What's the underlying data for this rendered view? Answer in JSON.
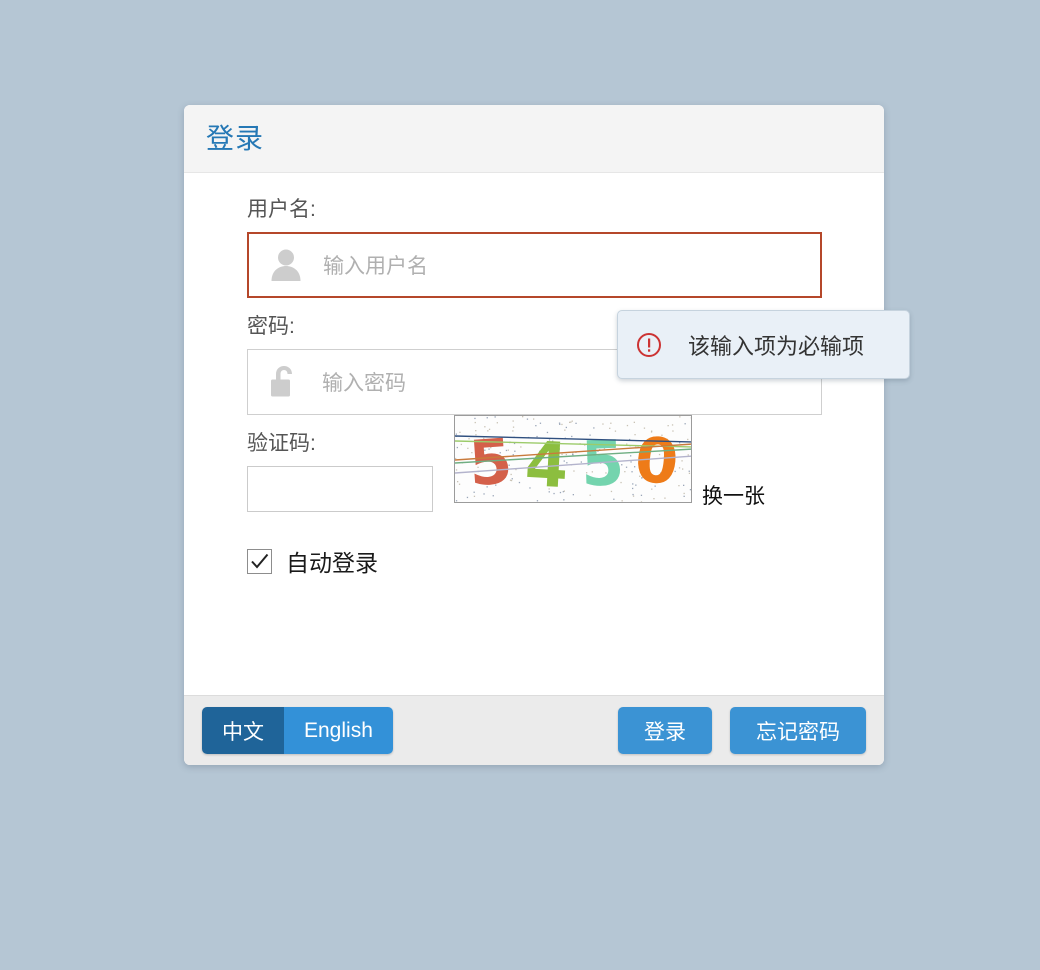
{
  "page": {
    "background_color": "#b5c6d4"
  },
  "panel": {
    "title": "登录",
    "title_color": "#2578b5"
  },
  "form": {
    "username": {
      "label": "用户名:",
      "placeholder": "输入用户名",
      "value": "",
      "icon": "user-icon",
      "error": true,
      "error_border_color": "#b5472a"
    },
    "password": {
      "label": "密码:",
      "placeholder": "输入密码",
      "value": "",
      "icon": "unlock-icon"
    },
    "captcha": {
      "label": "验证码:",
      "value": "",
      "placeholder": "",
      "image_text": "5450",
      "image_digits": [
        {
          "char": "5",
          "color": "#d4604a"
        },
        {
          "char": "4",
          "color": "#8cbe3f"
        },
        {
          "char": "5",
          "color": "#74d4ae"
        },
        {
          "char": "0",
          "color": "#ee7b18"
        }
      ],
      "refresh_label": "换一张"
    },
    "auto_login": {
      "label": "自动登录",
      "checked": true
    }
  },
  "tooltip": {
    "message": "该输入项为必输项",
    "icon": "error-circle-icon",
    "icon_color": "#cc3333",
    "background_color": "#e9f0f7"
  },
  "footer": {
    "language_toggle": {
      "options": [
        {
          "label": "中文",
          "active": true
        },
        {
          "label": "English",
          "active": false
        }
      ],
      "active_color": "#1f6499",
      "inactive_color": "#3391d8"
    },
    "buttons": [
      {
        "label": "登录",
        "name": "login-button"
      },
      {
        "label": "忘记密码",
        "name": "forgot-password-button"
      }
    ],
    "button_color": "#3b93d4"
  }
}
